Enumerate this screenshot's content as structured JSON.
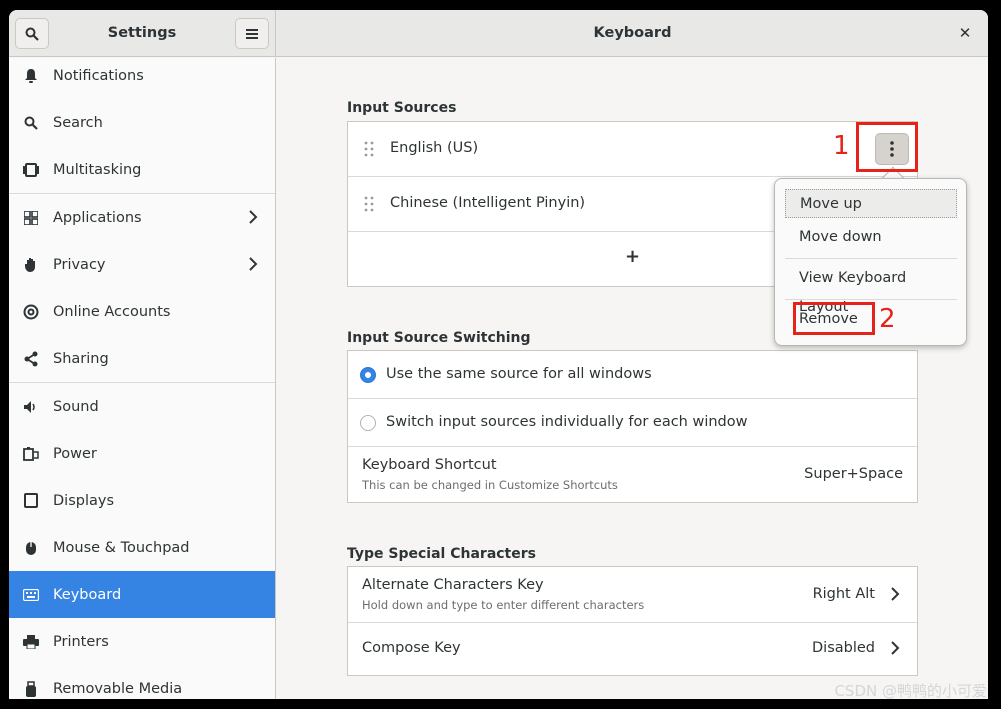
{
  "header": {
    "settings_title": "Settings",
    "page_title": "Keyboard",
    "close_glyph": "✕"
  },
  "sidebar": {
    "items": [
      {
        "label": "Notifications",
        "icon": "bell-icon"
      },
      {
        "label": "Search",
        "icon": "search-icon"
      },
      {
        "label": "Multitasking",
        "icon": "multitasking-icon"
      },
      {
        "label": "Applications",
        "icon": "grid-icon"
      },
      {
        "label": "Privacy",
        "icon": "hand-icon"
      },
      {
        "label": "Online Accounts",
        "icon": "at-icon"
      },
      {
        "label": "Sharing",
        "icon": "share-icon"
      },
      {
        "label": "Sound",
        "icon": "speaker-icon"
      },
      {
        "label": "Power",
        "icon": "power-icon"
      },
      {
        "label": "Displays",
        "icon": "display-icon"
      },
      {
        "label": "Mouse & Touchpad",
        "icon": "mouse-icon"
      },
      {
        "label": "Keyboard",
        "icon": "keyboard-icon"
      },
      {
        "label": "Printers",
        "icon": "printer-icon"
      },
      {
        "label": "Removable Media",
        "icon": "usb-icon"
      }
    ],
    "active": "Keyboard"
  },
  "input_sources": {
    "title": "Input Sources",
    "sources": [
      "English (US)",
      "Chinese (Intelligent Pinyin)"
    ],
    "add_glyph": "+"
  },
  "switching": {
    "title": "Input Source Switching",
    "option_same": "Use the same source for all windows",
    "option_individual": "Switch input sources individually for each window",
    "shortcut_label": "Keyboard Shortcut",
    "shortcut_sub": "This can be changed in Customize Shortcuts",
    "shortcut_value": "Super+Space"
  },
  "special_chars": {
    "title": "Type Special Characters",
    "alt_key_label": "Alternate Characters Key",
    "alt_key_sub": "Hold down and type to enter different characters",
    "alt_key_value": "Right Alt",
    "compose_label": "Compose Key",
    "compose_value": "Disabled"
  },
  "popover": {
    "move_up": "Move up",
    "move_down": "Move down",
    "view_layout": "View Keyboard Layout",
    "remove": "Remove"
  },
  "annotations": {
    "step1": "1",
    "step2": "2",
    "color": "#e6231b"
  },
  "watermark": "CSDN @鸭鸭的小可爱",
  "colors": {
    "accent": "#3584e4"
  }
}
